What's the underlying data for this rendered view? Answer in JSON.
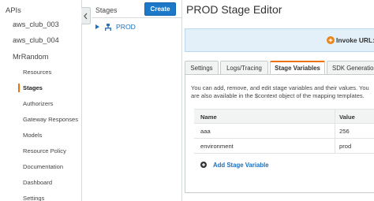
{
  "sidebar": {
    "root_label": "APIs",
    "apis": [
      "aws_club_003",
      "aws_club_004",
      "MrRandom"
    ],
    "items": [
      {
        "label": "Resources",
        "active": false
      },
      {
        "label": "Stages",
        "active": true
      },
      {
        "label": "Authorizers",
        "active": false
      },
      {
        "label": "Gateway Responses",
        "active": false
      },
      {
        "label": "Models",
        "active": false
      },
      {
        "label": "Resource Policy",
        "active": false
      },
      {
        "label": "Documentation",
        "active": false
      },
      {
        "label": "Dashboard",
        "active": false
      },
      {
        "label": "Settings",
        "active": false
      }
    ]
  },
  "stages_panel": {
    "title": "Stages",
    "create_label": "Create",
    "tree": [
      {
        "label": "PROD"
      }
    ]
  },
  "editor": {
    "title": "PROD Stage Editor",
    "invoke_label": "Invoke URL:",
    "tabs": [
      "Settings",
      "Logs/Tracing",
      "Stage Variables",
      "SDK Generation"
    ],
    "active_tab": "Stage Variables",
    "description_line1": "You can add, remove, and edit stage variables and their values. You",
    "description_line2": "are also available in the $context object of the mapping templates.",
    "table": {
      "headers": {
        "name": "Name",
        "value": "Value"
      },
      "rows": [
        {
          "name": "aaa",
          "value": "256"
        },
        {
          "name": "environment",
          "value": "prod"
        }
      ]
    },
    "add_label": "Add Stage Variable"
  },
  "colors": {
    "accent_orange": "#ec7211",
    "primary_blue": "#1c78c9",
    "link_blue": "#1a6fc0",
    "info_bg": "#e3f0fa"
  }
}
